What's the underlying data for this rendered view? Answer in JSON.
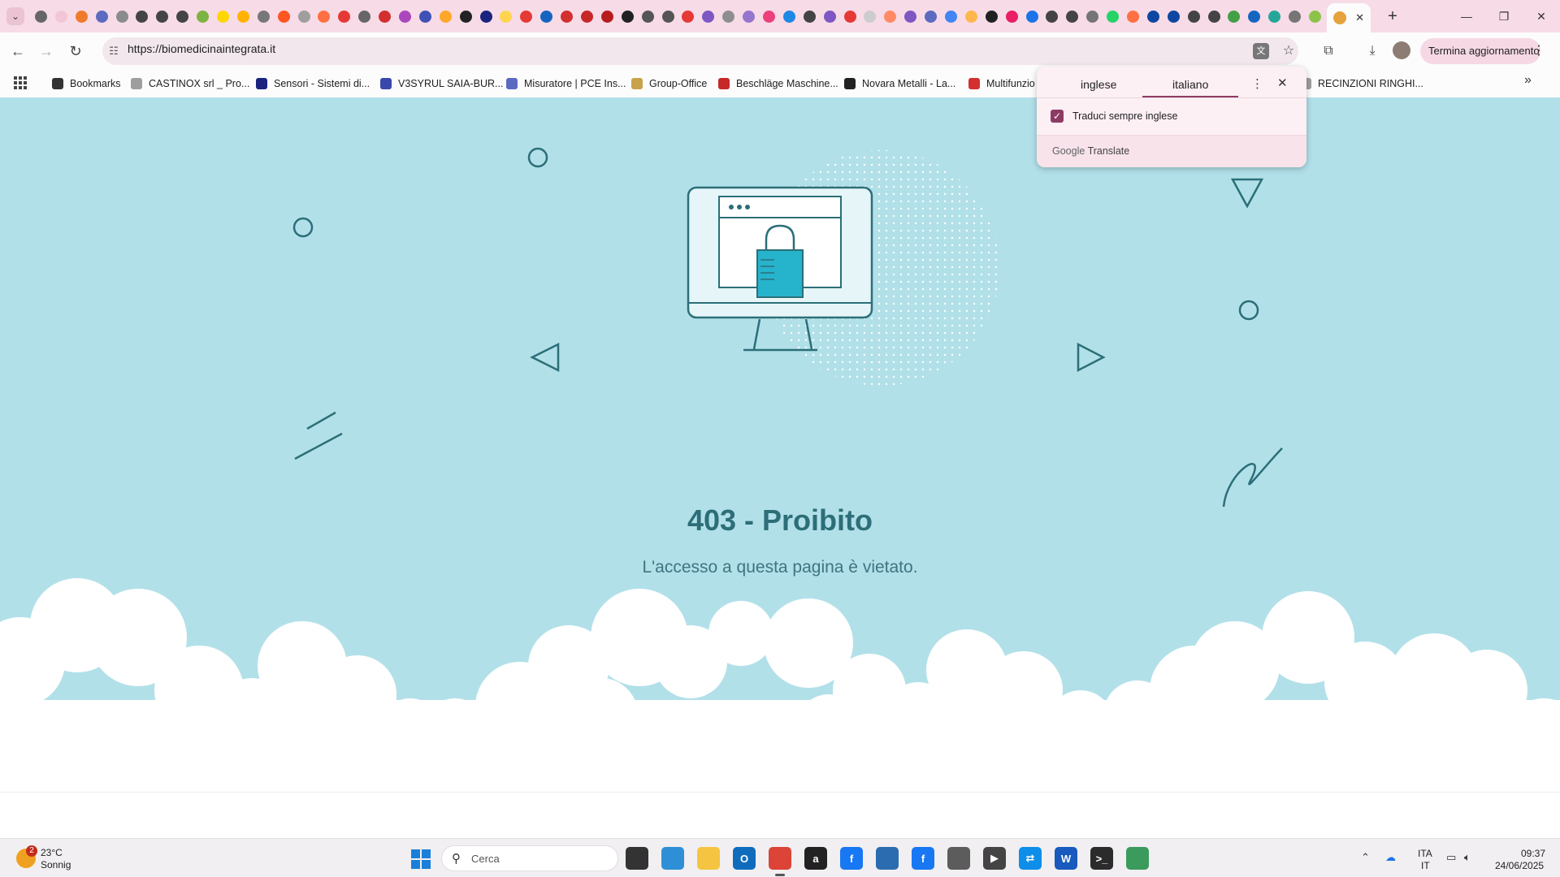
{
  "browser": {
    "active_tab_close": "✕",
    "new_tab": "+",
    "window_controls": [
      "—",
      "❐",
      "✕"
    ],
    "url": "https://biomedicinaintegrata.it",
    "update_button": "Termina aggiornamento",
    "tab_icon_colors": [
      "#666666",
      "#f2c6d4",
      "#ee7a2a",
      "#5c6bc0",
      "#8b8b8b",
      "#444444",
      "#444444",
      "#444444",
      "#7cb342",
      "#ffd600",
      "#ffb300",
      "#777777",
      "#ff5722",
      "#9e9e9e",
      "#ff7043",
      "#e53935",
      "#666666",
      "#d32f2f",
      "#ab47bc",
      "#3f51b5",
      "#ffa726",
      "#222222",
      "#1a237e",
      "#ffd54f",
      "#e53935",
      "#1565c0",
      "#d32f2f",
      "#c62828",
      "#b71c1c",
      "#212121",
      "#555555",
      "#555555",
      "#e53935",
      "#7e57c2",
      "#8e8e8e",
      "#9575cd",
      "#ec407a",
      "#1e88e5",
      "#444444",
      "#7e57c2",
      "#e53935",
      "#cccccc",
      "#ff8a65",
      "#7e57c2",
      "#5c6bc0",
      "#4285f4",
      "#ffb74d",
      "#212121",
      "#e91e63",
      "#1a73e8",
      "#444444",
      "#444444",
      "#757575",
      "#25d366",
      "#ff7043",
      "#0d47a1",
      "#0d47a1",
      "#444444",
      "#444444",
      "#43a047",
      "#1565c0",
      "#26a69a",
      "#757575",
      "#8bc34a"
    ]
  },
  "bookmarks": {
    "items": [
      {
        "label": "Bookmarks",
        "color": "#333333"
      },
      {
        "label": "CASTINOX srl _ Pro...",
        "color": "#9e9e9e"
      },
      {
        "label": "Sensori - Sistemi di...",
        "color": "#1a237e"
      },
      {
        "label": "V3SYRUL SAIA-BUR...",
        "color": "#3949ab"
      },
      {
        "label": "Misuratore | PCE Ins...",
        "color": "#5c6bc0"
      },
      {
        "label": "Group-Office",
        "color": "#c8a24a"
      },
      {
        "label": "Beschläge Maschine...",
        "color": "#c62828"
      },
      {
        "label": "Novara Metalli - La...",
        "color": "#212121"
      },
      {
        "label": "Multifunzio",
        "color": "#d32f2f"
      },
      {
        "label": "RECINZIONI RINGHI...",
        "color": "#9e9e9e"
      }
    ]
  },
  "translate_popup": {
    "source_lang": "inglese",
    "target_lang": "italiano",
    "always_translate": "Traduci sempre inglese",
    "always_checked": true,
    "brand": "Google",
    "brand_product": "Translate"
  },
  "page": {
    "title": "403 - Proibito",
    "description": "L'accesso a questa pagina è vietato.",
    "background_color": "#b2e0e9",
    "accent_color": "#2d6e78"
  },
  "taskbar": {
    "weather_badge": "2",
    "weather_temp": "23°C",
    "weather_condition": "Sonnig",
    "search_placeholder": "Cerca",
    "lang_line1": "ITA",
    "lang_line2": "IT",
    "time": "09:37",
    "date": "24/06/2025",
    "apps": [
      {
        "name": "file-explorer-dark",
        "color": "#333333",
        "glyph": ""
      },
      {
        "name": "copilot",
        "color": "#2f8fd6",
        "glyph": ""
      },
      {
        "name": "file-explorer",
        "color": "#f5c542",
        "glyph": ""
      },
      {
        "name": "outlook",
        "color": "#0f6cbd",
        "glyph": "O"
      },
      {
        "name": "chrome",
        "color": "#db4437",
        "glyph": ""
      },
      {
        "name": "amazon",
        "color": "#222222",
        "glyph": "a"
      },
      {
        "name": "facebook",
        "color": "#1877f2",
        "glyph": "f"
      },
      {
        "name": "search-app",
        "color": "#2b6cb0",
        "glyph": ""
      },
      {
        "name": "facebook-2",
        "color": "#1877f2",
        "glyph": "f"
      },
      {
        "name": "store",
        "color": "#5c5c5c",
        "glyph": ""
      },
      {
        "name": "media-player",
        "color": "#444444",
        "glyph": "▶"
      },
      {
        "name": "teamviewer",
        "color": "#0e8ee9",
        "glyph": "⇄"
      },
      {
        "name": "word",
        "color": "#185abd",
        "glyph": "W"
      },
      {
        "name": "terminal",
        "color": "#2b2b2b",
        "glyph": ">_"
      },
      {
        "name": "network-app",
        "color": "#3a9b5c",
        "glyph": ""
      }
    ]
  }
}
